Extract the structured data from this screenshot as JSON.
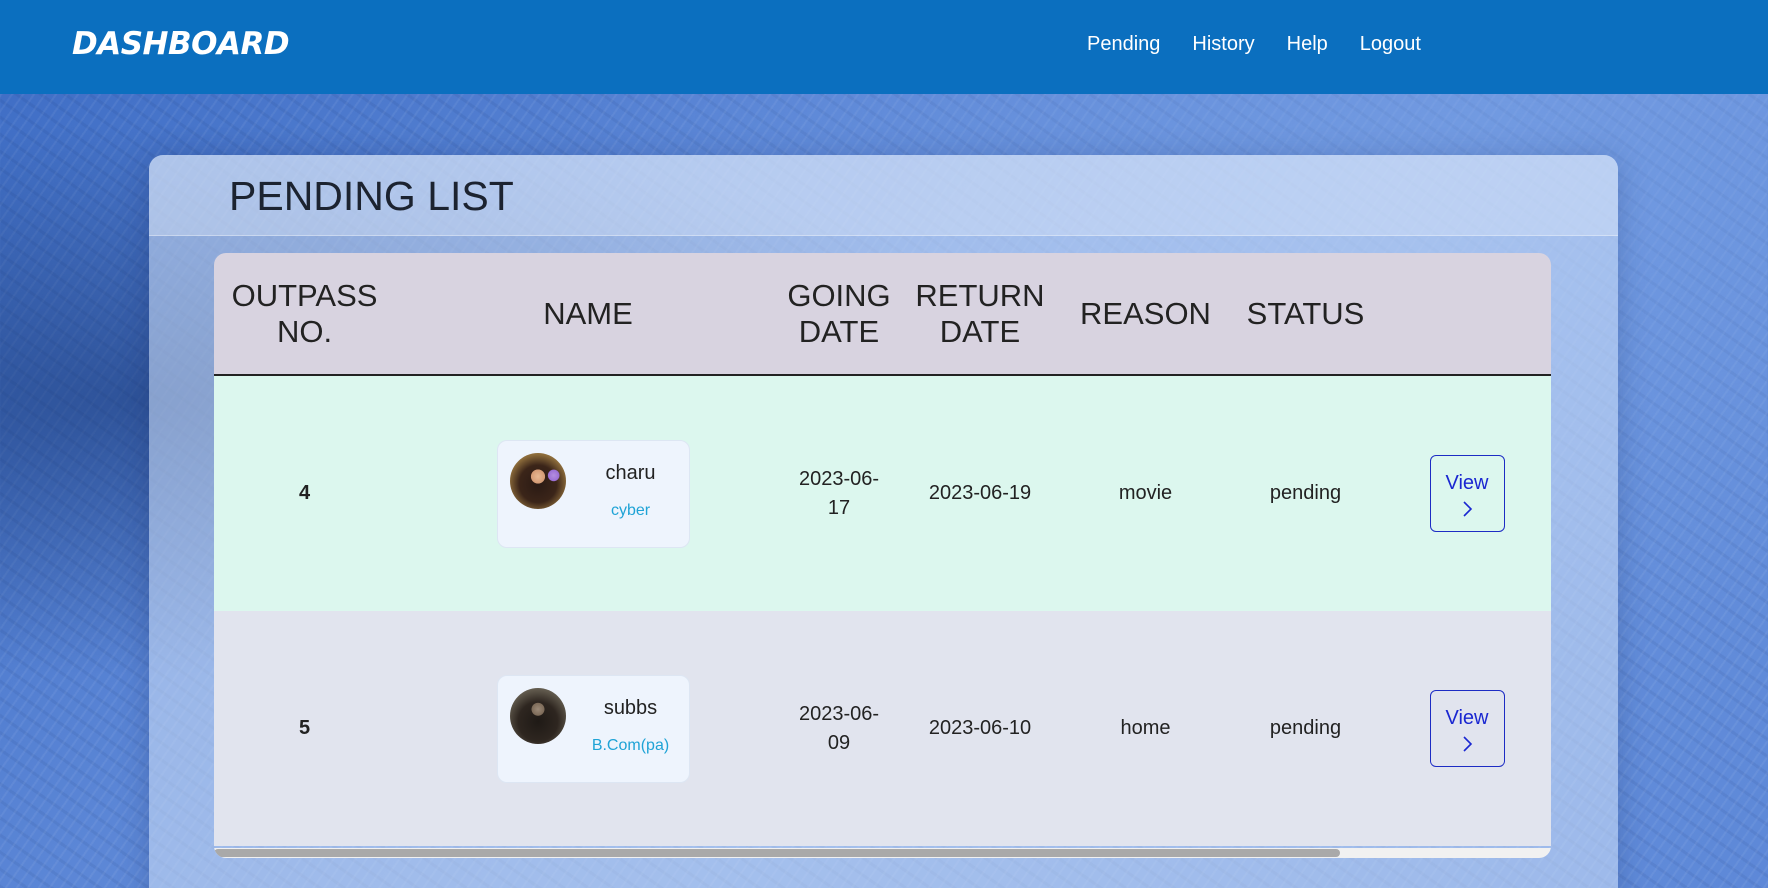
{
  "navbar": {
    "brand": "DASHBOARD",
    "links": [
      "Pending",
      "History",
      "Help",
      "Logout"
    ]
  },
  "panel": {
    "title": "PENDING LIST"
  },
  "table": {
    "headers": {
      "outpass_line1": "OUTPASS",
      "outpass_line2": "NO.",
      "name": "NAME",
      "going_line1": "GOING",
      "going_line2": "DATE",
      "return_line1": "RETURN",
      "return_line2": "DATE",
      "reason": "REASON",
      "status": "STATUS"
    },
    "rows": [
      {
        "outpass_no": "4",
        "name": "charu",
        "dept": "cyber",
        "going_line1": "2023-06-",
        "going_line2": "17",
        "return_date": "2023-06-19",
        "reason": "movie",
        "status": "pending",
        "action": "View"
      },
      {
        "outpass_no": "5",
        "name": "subbs",
        "dept": "B.Com(pa)",
        "going_line1": "2023-06-",
        "going_line2": "09",
        "return_date": "2023-06-10",
        "reason": "home",
        "status": "pending",
        "action": "View"
      }
    ]
  },
  "colors": {
    "navbar": "#0b6fbf",
    "row_highlight": "#dcf7ee",
    "row_alt": "#e1e4ee",
    "header_bg": "#d8d3e0",
    "view_button": "#1a27d1",
    "dept_text": "#1fa3d6"
  },
  "icons": {
    "view_button_icon": "chevron-right-icon"
  }
}
